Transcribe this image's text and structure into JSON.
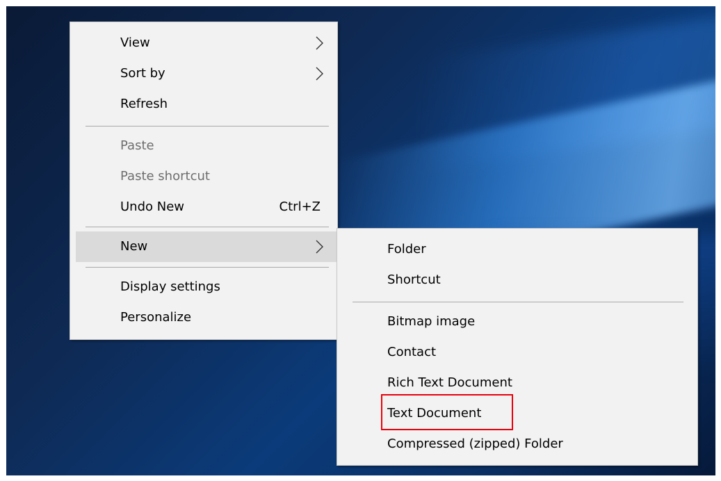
{
  "main_menu": {
    "items": [
      {
        "label": "View",
        "has_submenu": true
      },
      {
        "label": "Sort by",
        "has_submenu": true
      },
      {
        "label": "Refresh"
      },
      {
        "label": "Paste",
        "disabled": true
      },
      {
        "label": "Paste shortcut",
        "disabled": true
      },
      {
        "label": "Undo New",
        "shortcut": "Ctrl+Z"
      },
      {
        "label": "New",
        "has_submenu": true,
        "hovered": true
      },
      {
        "label": "Display settings"
      },
      {
        "label": "Personalize"
      }
    ]
  },
  "new_submenu": {
    "items": [
      {
        "label": "Folder"
      },
      {
        "label": "Shortcut"
      },
      {
        "label": "Bitmap image"
      },
      {
        "label": "Contact"
      },
      {
        "label": "Rich Text Document"
      },
      {
        "label": "Text Document",
        "highlighted": true
      },
      {
        "label": "Compressed (zipped) Folder"
      }
    ]
  },
  "colors": {
    "menu_bg": "#f2f2f2",
    "hover_bg": "#dadada",
    "disabled_text": "#6d6d6d",
    "highlight_border": "#e8000b"
  }
}
